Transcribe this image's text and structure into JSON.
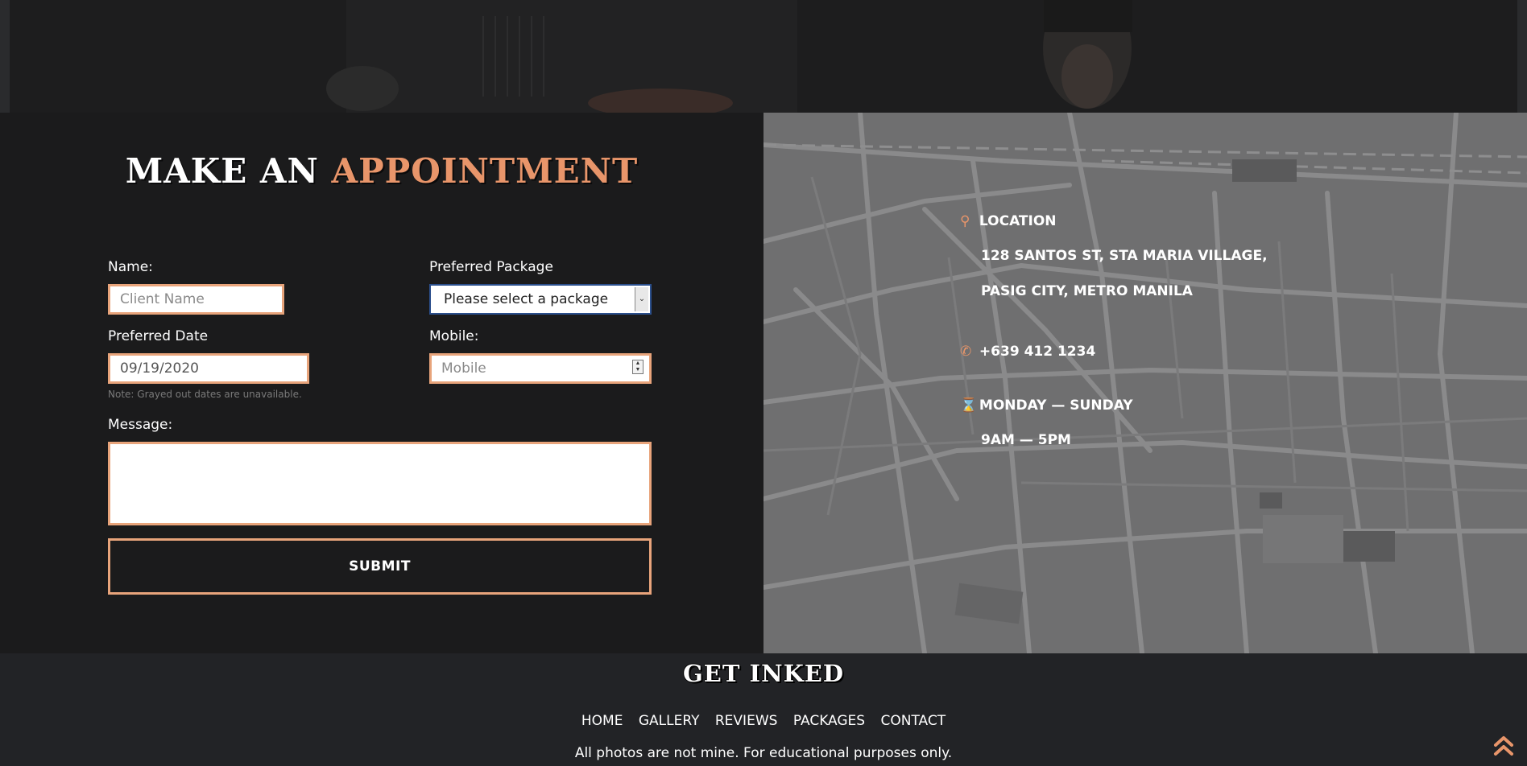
{
  "appointment": {
    "title_main": "MAKE AN",
    "title_accent": "APPOINTMENT",
    "name_label": "Name:",
    "name_placeholder": "Client Name",
    "package_label": "Preferred Package",
    "package_selected": "Please select a package",
    "date_label": "Preferred Date",
    "date_value": "09/19/2020",
    "date_note": "Note: Grayed out dates are unavailable.",
    "mobile_label": "Mobile:",
    "mobile_placeholder": "Mobile",
    "message_label": "Message:",
    "submit_label": "SUBMIT"
  },
  "contact_info": {
    "location_heading": "LOCATION",
    "address_line1": "128 SANTOS ST, STA MARIA VILLAGE,",
    "address_line2": "PASIG CITY, METRO MANILA",
    "phone": "+639 412 1234",
    "days": "MONDAY — SUNDAY",
    "hours": "9AM — 5PM"
  },
  "icons": {
    "location": "map-pin-icon",
    "phone": "phone-icon",
    "hours": "hourglass-icon",
    "back_to_top": "double-chevron-up-icon"
  },
  "footer": {
    "logo": "GET INKED",
    "nav": [
      "HOME",
      "GALLERY",
      "REVIEWS",
      "PACKAGES",
      "CONTACT"
    ],
    "note": "All photos are not mine. For educational purposes only."
  },
  "colors": {
    "accent": "#e8956a",
    "panel_bg": "#1b1b1c",
    "map_bg": "#6f6f70",
    "footer_bg": "#222326"
  }
}
